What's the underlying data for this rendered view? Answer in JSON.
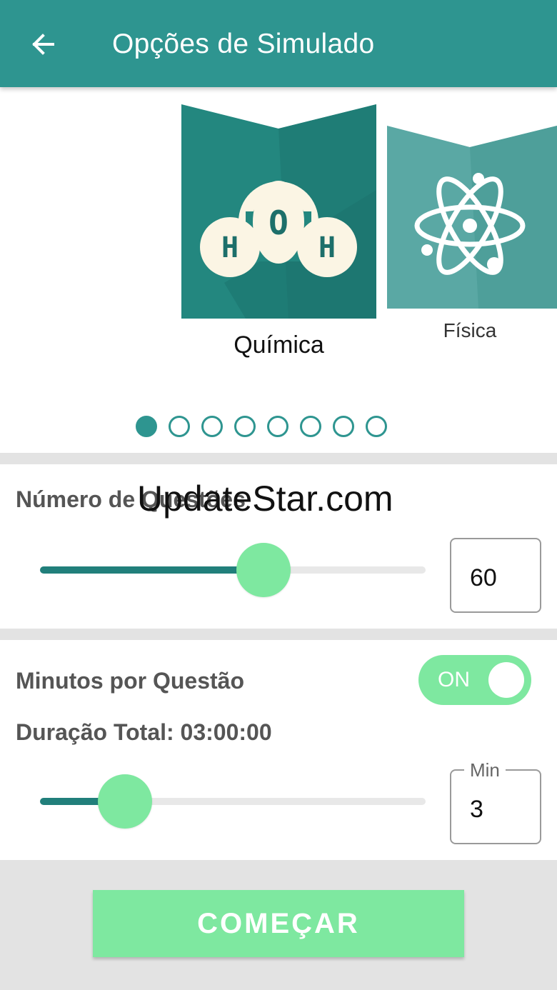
{
  "header": {
    "title": "Opções de Simulado",
    "back_icon": "arrow-left-icon"
  },
  "carousel": {
    "cards": [
      {
        "label": "Química",
        "icon": "water-molecule-icon",
        "letters": [
          "H",
          "O",
          "H"
        ],
        "selected": true
      },
      {
        "label": "Física",
        "icon": "atom-icon",
        "selected": false
      }
    ],
    "page_count": 8,
    "active_page": 1
  },
  "questions": {
    "label": "Número de Questões",
    "value": "60",
    "slider_fraction": 0.58
  },
  "timing": {
    "label": "Minutos por Questão",
    "toggle_label": "ON",
    "toggle_on": true,
    "total_duration": "Duração Total: 03:00:00",
    "minutes_caption": "Min",
    "minutes_value": "3",
    "slider_fraction": 0.22
  },
  "footer": {
    "start_label": "COMEÇAR"
  },
  "watermark": "UpdateStar.com",
  "colors": {
    "primary": "#2e9590",
    "accent": "#7ee8a0",
    "slider_fill": "#217f7b",
    "background_gray": "#e3e3e3"
  }
}
